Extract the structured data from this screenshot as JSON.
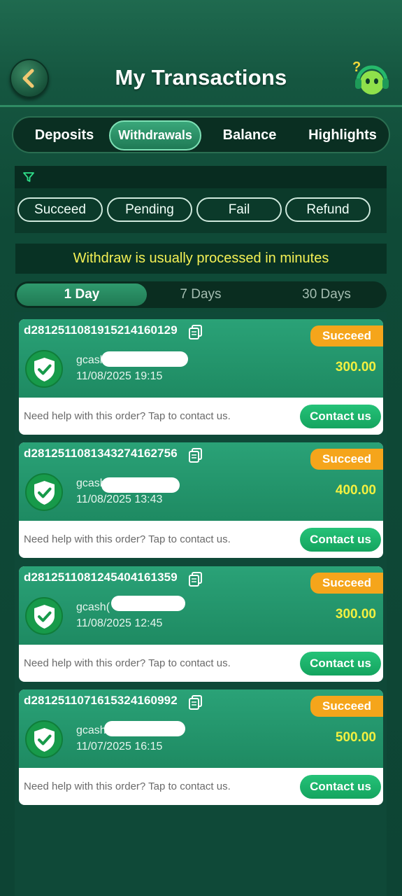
{
  "header": {
    "title": "My Transactions",
    "back_icon": "chevron-left-icon",
    "support_icon": "support-agent-icon"
  },
  "tabs": [
    {
      "label": "Deposits",
      "active": false
    },
    {
      "label": "Withdrawals",
      "active": true
    },
    {
      "label": "Balance",
      "active": false
    },
    {
      "label": "Highlights",
      "active": false
    }
  ],
  "filters": {
    "icon": "filter-icon",
    "chips": [
      "Succeed",
      "Pending",
      "Fail",
      "Refund"
    ]
  },
  "notice": "Withdraw is usually processed in minutes",
  "periods": [
    {
      "label": "1 Day",
      "active": true
    },
    {
      "label": "7 Days",
      "active": false
    },
    {
      "label": "30 Days",
      "active": false
    }
  ],
  "transactions": [
    {
      "order_id": "d28125110819152141601​29",
      "status": "Succeed",
      "account": "gcash",
      "datetime": "11/08/2025 19:15",
      "amount": "300.00",
      "help": "Need help with this order? Tap to contact us.",
      "contact": "Contact us"
    },
    {
      "order_id": "d2812511081343274162756",
      "status": "Succeed",
      "account": "gcash",
      "datetime": "11/08/2025 13:43",
      "amount": "400.00",
      "help": "Need help with this order? Tap to contact us.",
      "contact": "Contact us"
    },
    {
      "order_id": "d2812511081245404161359",
      "status": "Succeed",
      "account": "gcash(",
      "datetime": "11/08/2025 12:45",
      "amount": "300.00",
      "help": "Need help with this order? Tap to contact us.",
      "contact": "Contact us"
    },
    {
      "order_id": "d2812511071615324160992",
      "status": "Succeed",
      "account": "gcash",
      "datetime": "11/07/2025 16:15",
      "amount": "500.00",
      "help": "Need help with this order? Tap to contact us.",
      "contact": "Contact us"
    }
  ],
  "colors": {
    "accent": "#1f8a62",
    "status_succeed": "#f5a51b",
    "amount": "#f2f040",
    "notice": "#f4f055"
  }
}
